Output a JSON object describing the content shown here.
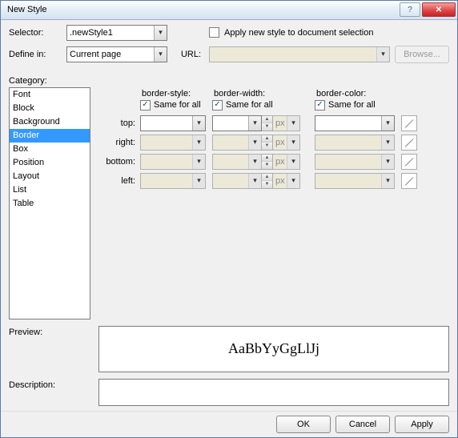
{
  "window": {
    "title": "New Style"
  },
  "form": {
    "selector_label": "Selector:",
    "selector_value": ".newStyle1",
    "define_label": "Define in:",
    "define_value": "Current page",
    "url_label": "URL:",
    "url_value": "",
    "browse_label": "Browse...",
    "apply_doc_label": "Apply new style to document selection",
    "apply_doc_checked": false
  },
  "category": {
    "label": "Category:",
    "items": [
      "Font",
      "Block",
      "Background",
      "Border",
      "Box",
      "Position",
      "Layout",
      "List",
      "Table"
    ],
    "selected_index": 3
  },
  "border": {
    "headers": {
      "style": "border-style:",
      "width": "border-width:",
      "color": "border-color:"
    },
    "same_label": "Same for all",
    "same_checked": {
      "style": true,
      "width": true,
      "color": true
    },
    "sides": [
      "top:",
      "right:",
      "bottom:",
      "left:"
    ],
    "unit": "px"
  },
  "preview": {
    "label": "Preview:",
    "sample": "AaBbYyGgLlJj"
  },
  "description": {
    "label": "Description:",
    "text": ""
  },
  "buttons": {
    "ok": "OK",
    "cancel": "Cancel",
    "apply": "Apply"
  }
}
